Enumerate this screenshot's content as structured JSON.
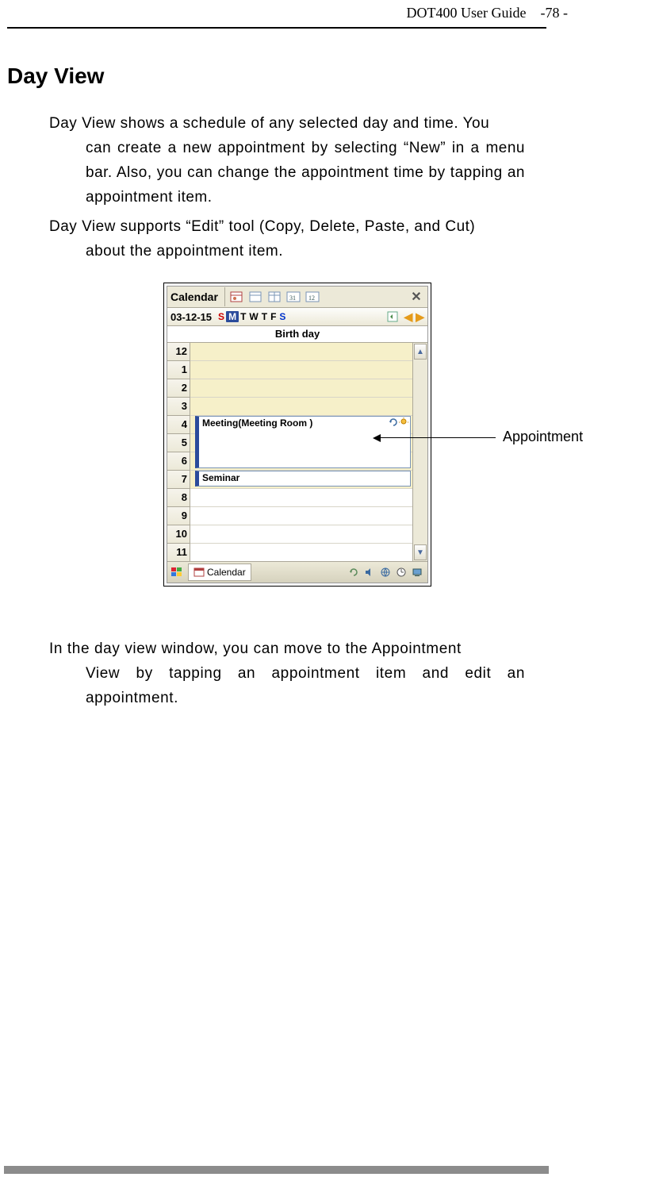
{
  "header": {
    "guide": "DOT400 User Guide",
    "page": "-78 -"
  },
  "section_title": "Day View",
  "para1_lead": "Day View shows a schedule of any selected day and time. You",
  "para1_body": "can create a new appointment by selecting “New” in a menu bar. Also, you can change the appointment time by tapping an appointment item.",
  "para2_lead": "Day View supports “Edit” tool (Copy, Delete, Paste, and Cut)",
  "para2_body": "about the appointment item.",
  "para3_lead": "In the day view window, you can move to the Appointment",
  "para3_body": "View by tapping an appointment item and edit an appointment.",
  "callout": "Appointment",
  "calendar": {
    "title": "Calendar",
    "date": "03-12-15",
    "dow": {
      "s1": "S",
      "m": "M",
      "t1": "T",
      "w": "W",
      "t2": "T",
      "f": "F",
      "s2": "S"
    },
    "allday": "Birth day",
    "hours": [
      "12",
      "1",
      "2",
      "3",
      "4",
      "5",
      "6",
      "7",
      "8",
      "9",
      "10",
      "11"
    ],
    "appt1_text": "Meeting(Meeting Room )",
    "appt2_text": "Seminar",
    "taskbar_label": "Calendar"
  }
}
